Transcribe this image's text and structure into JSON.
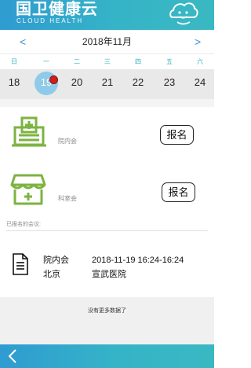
{
  "header": {
    "logo_main": "国卫健康云",
    "logo_sub": "CLOUD HEALTH",
    "avatar_icon": "cartoon-avatar-icon"
  },
  "calendar": {
    "prev_label": "<",
    "next_label": ">",
    "month_title": "2018年11月",
    "weekdays": [
      "日",
      "一",
      "二",
      "三",
      "四",
      "五",
      "六"
    ],
    "dates": [
      "18",
      "19",
      "20",
      "21",
      "22",
      "23",
      "24"
    ],
    "selected_date": "19"
  },
  "categories": [
    {
      "label": "院内会",
      "button": "报名",
      "icon": "hospital-icon"
    },
    {
      "label": "科室会",
      "button": "报名",
      "icon": "clinic-shop-icon"
    }
  ],
  "signed_section": {
    "label": "已报名的会议:",
    "meetings": [
      {
        "type": "院内会",
        "time": "2018-11-19 16:24-16:24",
        "city": "北京",
        "hospital": "宣武医院",
        "icon": "document-icon"
      }
    ]
  },
  "no_more_text": "没有更多数据了",
  "footer": {
    "back_icon": "back-arrow-icon"
  },
  "colors": {
    "header_start": "#2f9bd1",
    "header_end": "#3ab8c2",
    "icon_green": "#7cb342",
    "selected_circle": "#8ecbe9",
    "dot_red": "#d01e1e",
    "nav_blue": "#3a8fd4",
    "weekday_teal": "#3ab0c0"
  }
}
